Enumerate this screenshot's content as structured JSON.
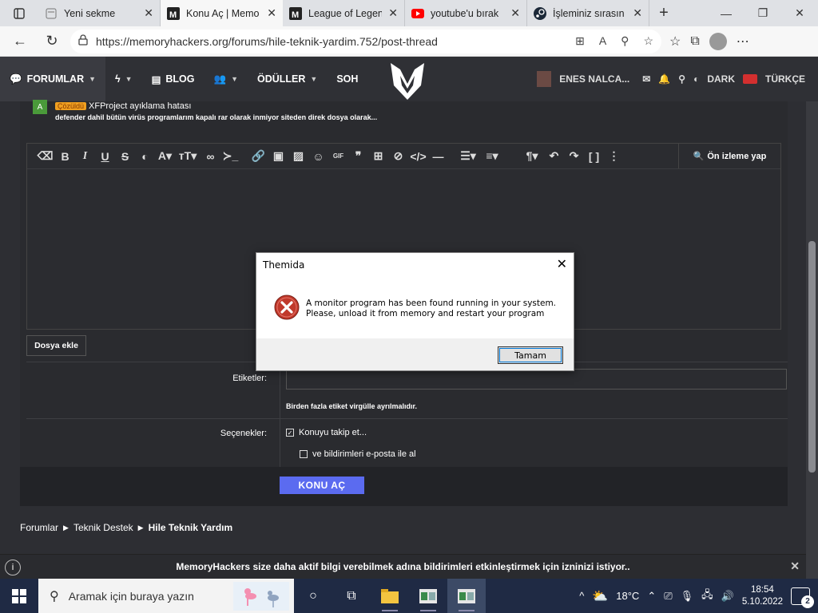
{
  "browser": {
    "tabs": [
      {
        "title": "Yeni sekme",
        "icon": "new-tab-page-icon",
        "active": false
      },
      {
        "title": "Konu Aç | Memo",
        "icon": "memoryhackers-favicon",
        "active": true
      },
      {
        "title": "League of Legen",
        "icon": "memoryhackers-favicon",
        "active": false
      },
      {
        "title": "youtube'u bırak",
        "icon": "youtube-favicon",
        "active": false
      },
      {
        "title": "İşleminiz sırasın",
        "icon": "steam-favicon",
        "active": false
      }
    ],
    "url": "https://memoryhackers.org/forums/hile-teknik-yardim.752/post-thread"
  },
  "site_nav": {
    "forums": "FORUMLAR",
    "blog": "BLOG",
    "awards": "ÖDÜLLER",
    "chat": "SOH",
    "username": "ENES NALCA...",
    "theme": "DARK",
    "language": "TÜRKÇE"
  },
  "thread": {
    "avatar_letter": "A",
    "badge": "Çözüldü",
    "title": "XFProject ayıklama hatası",
    "snippet": "defender dahil bütün virüs programlarım kapalı rar olarak inmiyor siteden direk dosya olarak..."
  },
  "editor": {
    "preview": "Ön izleme yap",
    "attach": "Dosya ekle"
  },
  "form": {
    "tags_label": "Etiketler:",
    "tags_hint": "Birden fazla etiket virgülle ayrılmalıdır.",
    "options_label": "Seçenekler:",
    "opt_watch": "Konuyu takip et...",
    "opt_email": "ve bildirimleri e-posta ile al",
    "submit": "KONU AÇ"
  },
  "breadcrumb": [
    "Forumlar",
    "Teknik Destek",
    "Hile Teknik Yardım"
  ],
  "notification": "MemoryHackers size daha aktif bilgi verebilmek adına bildirimleri etkinleştirmek için izninizi istiyor..",
  "dialog": {
    "title": "Themida",
    "line1": "A monitor program has been found running in your system.",
    "line2": "Please, unload it from memory and restart your program",
    "ok": "Tamam"
  },
  "taskbar": {
    "search_placeholder": "Aramak için buraya yazın",
    "temperature": "18°C",
    "time": "18:54",
    "date": "5.10.2022",
    "notification_count": "2"
  },
  "colors": {
    "accent": "#5b6bf0",
    "badge": "#f0a020",
    "error": "#c0392b"
  }
}
